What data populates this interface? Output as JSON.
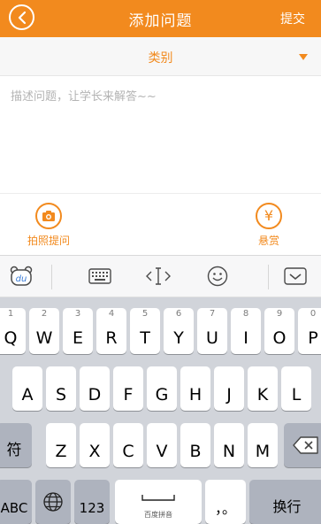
{
  "header": {
    "title": "添加问题",
    "submit_label": "提交",
    "accent_color": "#f28a1e"
  },
  "category": {
    "label": "类别"
  },
  "description": {
    "placeholder": "描述问题，让学长来解答~~",
    "value": ""
  },
  "actions": {
    "photo_label": "拍照提问",
    "reward_label": "悬赏",
    "reward_symbol": "¥"
  },
  "keyboard_toolbar": {
    "items": [
      {
        "icon": "baidu-du-icon",
        "label": "du"
      },
      {
        "icon": "keyboard-icon"
      },
      {
        "icon": "cursor-move-icon"
      },
      {
        "icon": "emoji-icon"
      },
      {
        "icon": "chevron-down-icon"
      }
    ]
  },
  "keyboard": {
    "row1": [
      {
        "char": "Q",
        "num": "1"
      },
      {
        "char": "W",
        "num": "2"
      },
      {
        "char": "E",
        "num": "3"
      },
      {
        "char": "R",
        "num": "4"
      },
      {
        "char": "T",
        "num": "5"
      },
      {
        "char": "Y",
        "num": "6"
      },
      {
        "char": "U",
        "num": "7"
      },
      {
        "char": "I",
        "num": "8"
      },
      {
        "char": "O",
        "num": "9"
      },
      {
        "char": "P",
        "num": "0"
      }
    ],
    "row2": [
      "A",
      "S",
      "D",
      "F",
      "G",
      "H",
      "J",
      "K",
      "L"
    ],
    "row3": [
      "Z",
      "X",
      "C",
      "V",
      "B",
      "N",
      "M"
    ],
    "symbol_key": "符",
    "abc_key": "ABC",
    "num_key": "123",
    "space_caption": "百度拼音",
    "punct_key": "，。",
    "return_key": "换行"
  }
}
